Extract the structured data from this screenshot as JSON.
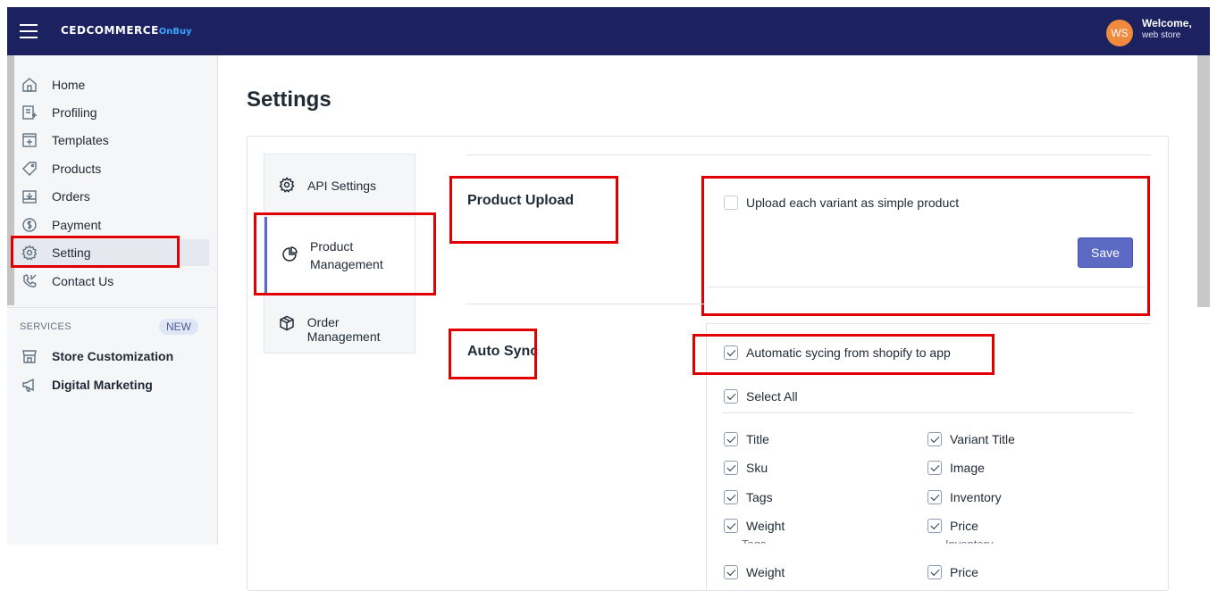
{
  "header": {
    "brand": "CEDCOMMERCE",
    "brand_suffix": "OnBuy",
    "avatar_initials": "WS",
    "welcome": "Welcome,",
    "user": "web store"
  },
  "sidebar": {
    "items": [
      {
        "label": "Home",
        "icon": "home-icon"
      },
      {
        "label": "Profiling",
        "icon": "profiling-icon"
      },
      {
        "label": "Templates",
        "icon": "templates-icon"
      },
      {
        "label": "Products",
        "icon": "tag-icon"
      },
      {
        "label": "Orders",
        "icon": "orders-icon"
      },
      {
        "label": "Payment",
        "icon": "dollar-icon"
      },
      {
        "label": "Setting",
        "icon": "gear-icon",
        "active": true
      },
      {
        "label": "Contact Us",
        "icon": "phone-icon"
      }
    ],
    "services_label": "SERVICES",
    "new_badge": "NEW",
    "services": [
      {
        "label": "Store Customization",
        "icon": "store-icon"
      },
      {
        "label": "Digital Marketing",
        "icon": "megaphone-icon"
      }
    ]
  },
  "main": {
    "title": "Settings",
    "tabs": [
      {
        "label": "API Settings",
        "icon": "gear-icon"
      },
      {
        "label": "Product Management",
        "icon": "pie-chart-icon",
        "active": true
      },
      {
        "label": "Order Management",
        "icon": "box-icon"
      }
    ],
    "product_upload": {
      "title": "Product Upload",
      "checkbox_label": "Upload each variant as simple product",
      "checked": false,
      "save_label": "Save"
    },
    "auto_sync": {
      "title": "Auto Sync",
      "auto_label": "Automatic sycing from shopify to app",
      "select_all": "Select All",
      "fields": [
        {
          "left": "Title",
          "right": "Variant Title"
        },
        {
          "left": "Sku",
          "right": "Image"
        },
        {
          "left": "Tags",
          "right": "Inventory"
        },
        {
          "left": "Weight",
          "right": "Price"
        }
      ],
      "overlap_row": {
        "left": "Tags",
        "right": "Inventory"
      },
      "repeat_row": {
        "left": "Weight",
        "right": "Price"
      }
    }
  },
  "colors": {
    "topbar": "#1c2260",
    "accent": "#5c6ac4",
    "highlight": "#e00000",
    "avatar": "#f08a3e"
  }
}
